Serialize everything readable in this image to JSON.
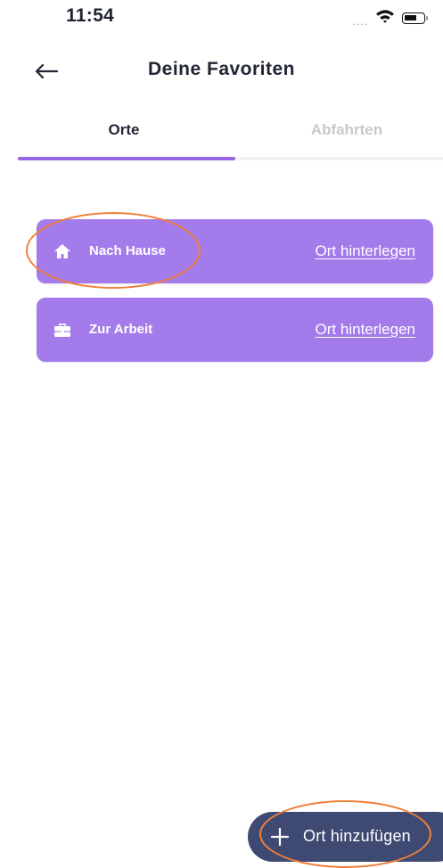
{
  "status_bar": {
    "time": "11:54",
    "signal": "....",
    "icons": [
      "wifi-icon",
      "battery-icon"
    ]
  },
  "header": {
    "title": "Deine Favoriten",
    "back_icon": "arrow-left-icon"
  },
  "tabs": [
    {
      "label": "Orte",
      "active": true
    },
    {
      "label": "Abfahrten",
      "active": false
    }
  ],
  "places": [
    {
      "icon": "home-icon",
      "label": "Nach Hause",
      "action": "Ort hinterlegen"
    },
    {
      "icon": "briefcase-icon",
      "label": "Zur Arbeit",
      "action": "Ort hinterlegen"
    }
  ],
  "fab": {
    "icon": "plus-icon",
    "label": "Ort hinzufügen"
  },
  "colors": {
    "accent": "#9966e6",
    "card_background": "#a47bea",
    "fab_background": "#3f4a73",
    "highlight": "#f07f3c"
  }
}
